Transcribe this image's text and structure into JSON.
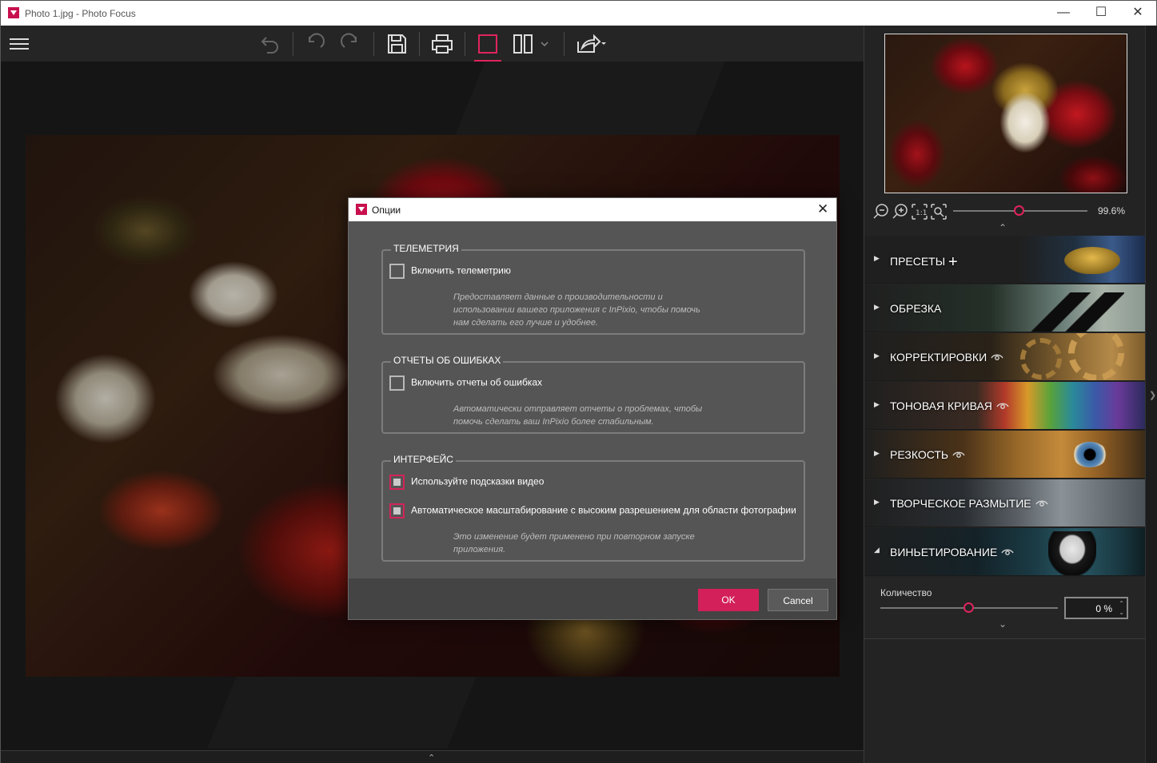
{
  "window": {
    "title": "Photo 1.jpg - Photo Focus"
  },
  "toolbar": {
    "icons": [
      "undo-all-icon",
      "undo-icon",
      "redo-icon",
      "save-icon",
      "print-icon",
      "single-view-icon",
      "split-view-icon",
      "dropdown-chevron-icon",
      "share-icon"
    ],
    "accent": "#e0245e"
  },
  "navigator": {
    "zoom_value": "99.6%"
  },
  "panels": [
    {
      "label": "ПРЕСЕТЫ",
      "extra": "+",
      "expanded": false
    },
    {
      "label": "ОБРЕЗКА",
      "expanded": false
    },
    {
      "label": "КОРРЕКТИРОВКИ",
      "eye": true,
      "expanded": false
    },
    {
      "label": "ТОНОВАЯ КРИВАЯ",
      "eye": true,
      "expanded": false
    },
    {
      "label": "РЕЗКОСТЬ",
      "eye": true,
      "expanded": false
    },
    {
      "label": "ТВОРЧЕСКОЕ РАЗМЫТИЕ",
      "eye": true,
      "expanded": false
    },
    {
      "label": "ВИНЬЕТИРОВАНИЕ",
      "eye": true,
      "expanded": true
    }
  ],
  "vignette": {
    "amount_label": "Количество",
    "amount_value": "0 %",
    "amount_level": 0.5
  },
  "dialog": {
    "title": "Опции",
    "telemetry": {
      "legend": "ТЕЛЕМЕТРИЯ",
      "checkbox_label": "Включить телеметрию",
      "checked": false,
      "desc_line1": "Предоставляет данные о производительности и",
      "desc_line2": "использовании вашего приложения с InPixio, чтобы помочь",
      "desc_line3": "нам сделать его лучше и удобнее."
    },
    "errors": {
      "legend": "ОТЧЕТЫ ОБ ОШИБКАХ",
      "checkbox_label": "Включить отчеты об ошибках",
      "checked": false,
      "desc_line1": "Автоматически отправляет отчеты о проблемах, чтобы",
      "desc_line2": "помочь сделать ваш InPixio более стабильным."
    },
    "interface": {
      "legend": "ИНТЕРФЕЙС",
      "video_hints_label": "Используйте подсказки видео",
      "autoscale_label": "Автоматическое масштабирование с высоким разрешением для области фотографии",
      "desc_line1": "Это изменение будет применено при повторном запуске",
      "desc_line2": "приложения."
    },
    "ok_label": "OK",
    "cancel_label": "Cancel"
  }
}
